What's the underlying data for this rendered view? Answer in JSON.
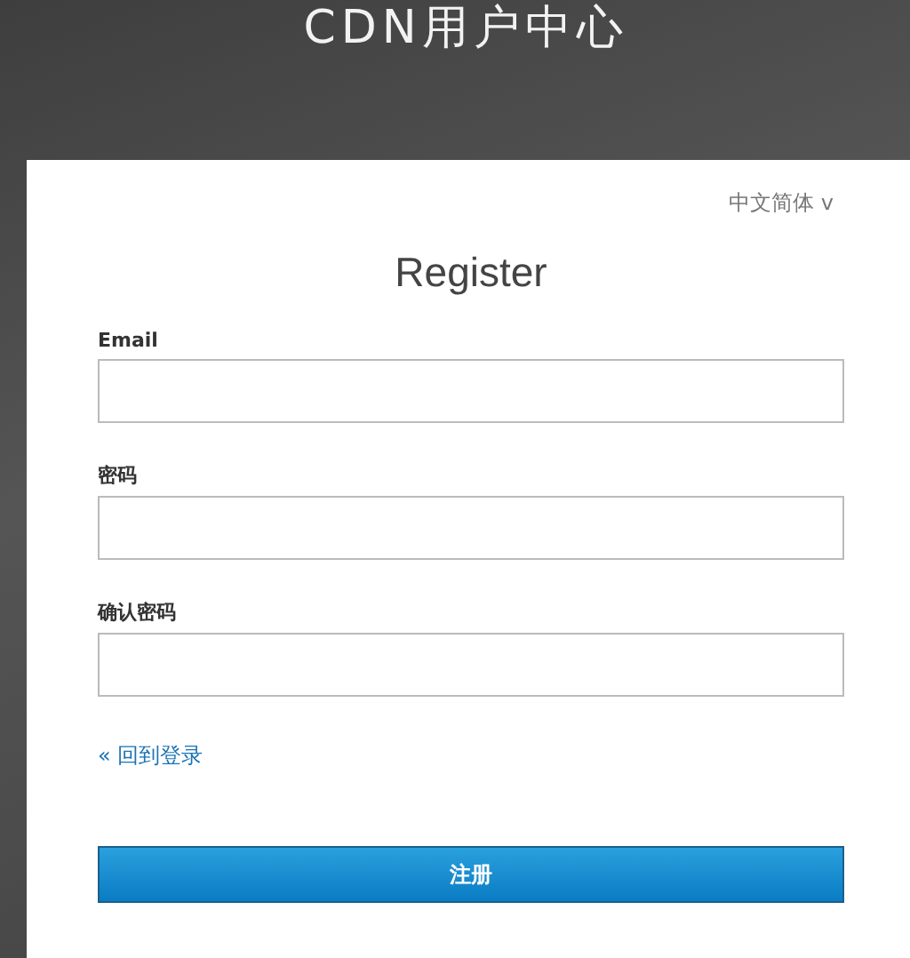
{
  "header": {
    "title": "CDN用户中心"
  },
  "language": {
    "label": "中文简体",
    "caret": "v"
  },
  "form": {
    "title": "Register",
    "fields": [
      {
        "label": "Email"
      },
      {
        "label": "密码"
      },
      {
        "label": "确认密码"
      }
    ],
    "back_link": {
      "arrow": "«",
      "label": "回到登录"
    },
    "submit": "注册"
  }
}
